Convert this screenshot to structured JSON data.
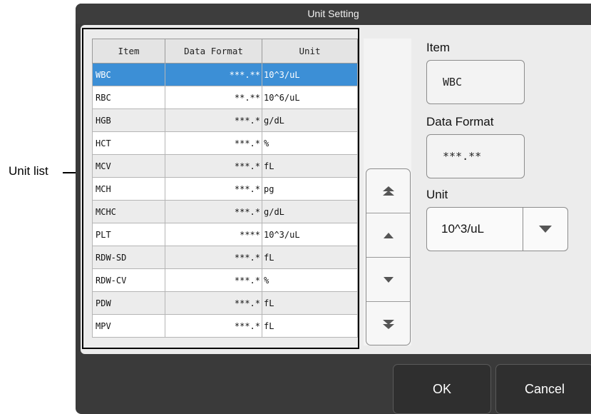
{
  "callout": {
    "label": "Unit list"
  },
  "dialog": {
    "title": "Unit Setting",
    "table": {
      "headers": [
        "Item",
        "Data Format",
        "Unit"
      ],
      "rows": [
        {
          "item": "WBC",
          "format": "***.**",
          "unit": "10^3/uL"
        },
        {
          "item": "RBC",
          "format": "**.**",
          "unit": "10^6/uL"
        },
        {
          "item": "HGB",
          "format": "***.*",
          "unit": "g/dL"
        },
        {
          "item": "HCT",
          "format": "***.*",
          "unit": "%"
        },
        {
          "item": "MCV",
          "format": "***.*",
          "unit": "fL"
        },
        {
          "item": "MCH",
          "format": "***.*",
          "unit": "pg"
        },
        {
          "item": "MCHC",
          "format": "***.*",
          "unit": "g/dL"
        },
        {
          "item": "PLT",
          "format": "****",
          "unit": "10^3/uL"
        },
        {
          "item": "RDW-SD",
          "format": "***.*",
          "unit": "fL"
        },
        {
          "item": "RDW-CV",
          "format": "***.*",
          "unit": "%"
        },
        {
          "item": "PDW",
          "format": "***.*",
          "unit": "fL"
        },
        {
          "item": "MPV",
          "format": "***.*",
          "unit": "fL"
        }
      ],
      "selected_row": 0
    },
    "scroll_buttons": [
      "page-up-icon",
      "up-icon",
      "down-icon",
      "page-down-icon"
    ],
    "fields": {
      "item_label": "Item",
      "item_value": "WBC",
      "format_label": "Data Format",
      "format_value": "***.**",
      "unit_label": "Unit",
      "unit_value": "10^3/uL"
    },
    "buttons": {
      "ok": "OK",
      "cancel": "Cancel"
    },
    "colors": {
      "selected_row": "#3c8fd6",
      "dialog_bg": "#3a3a3a",
      "panel_bg": "#ececec"
    }
  }
}
